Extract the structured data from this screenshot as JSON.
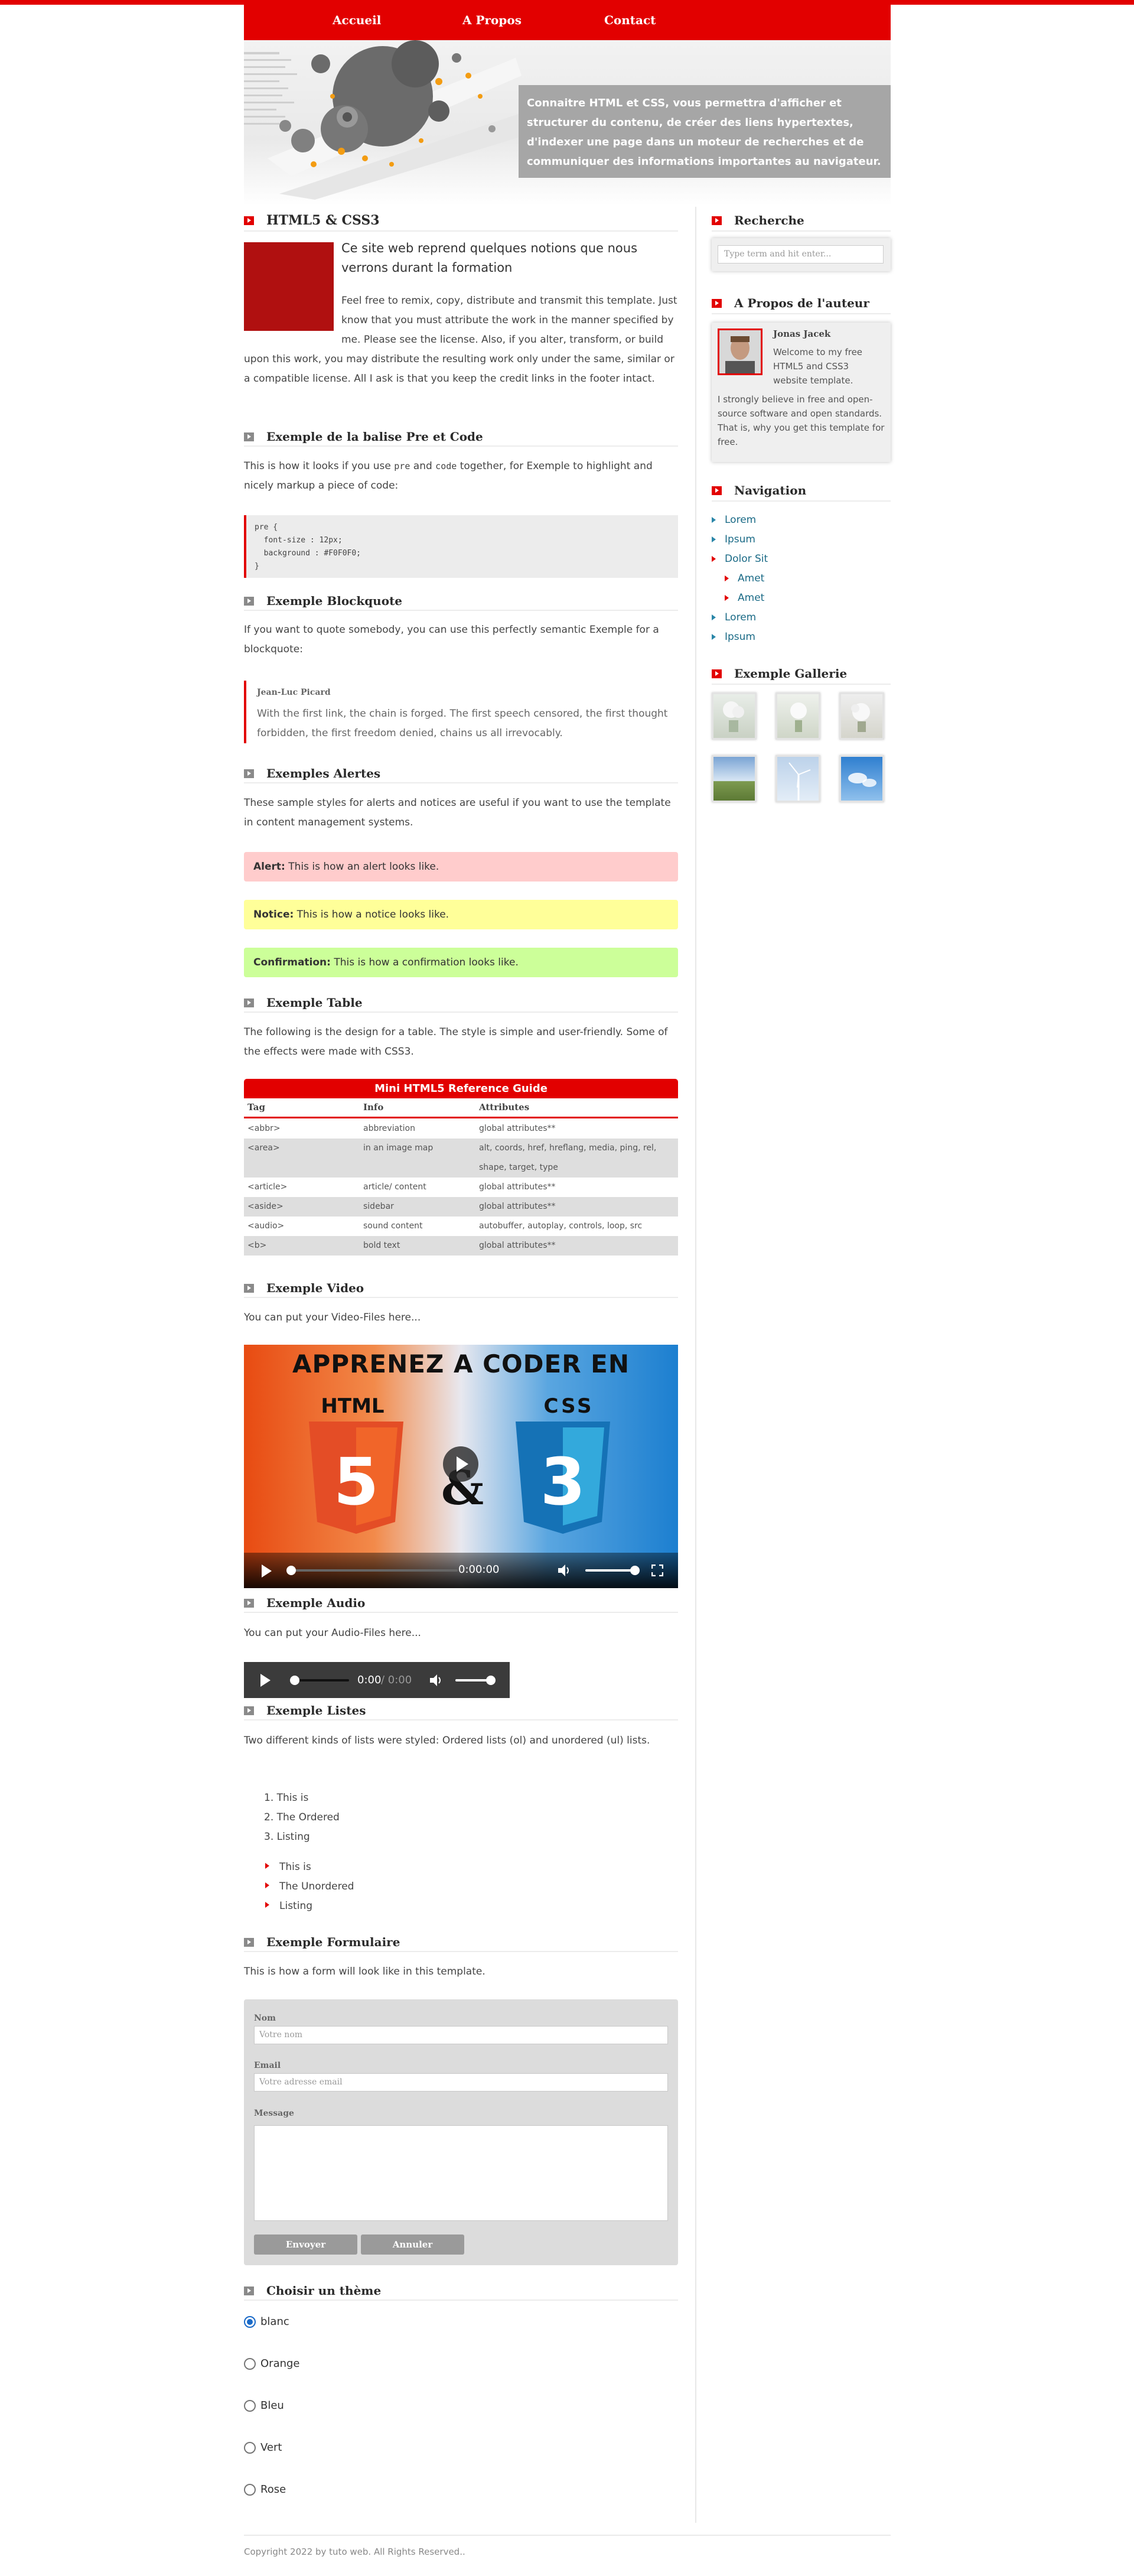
{
  "nav": {
    "home": "Accueil",
    "about": "A Propos",
    "contact": "Contact"
  },
  "banner": {
    "text": "Connaitre HTML et CSS, vous permettra d'afficher et structurer du contenu, de créer des liens hypertextes, d'indexer une page dans un moteur de recherches et de communiquer des informations importantes au navigateur."
  },
  "intro": {
    "title": "HTML5 & CSS3",
    "lead": "Ce site web reprend quelques notions que nous verrons durant la formation",
    "body": "Feel free to remix, copy, distribute and transmit this template. Just know that you must attribute the work in the manner specified by me. Please see the license. Also, if you alter, transform, or build upon this work, you may distribute the resulting work only under the same, similar or a compatible license. All I ask is that you keep the credit links in the footer intact."
  },
  "pre": {
    "title": "Exemple de la balise Pre et Code",
    "text_a": "This is how it looks if you use ",
    "code1": "pre",
    "text_b": " and ",
    "code2": "code",
    "text_c": " together, for Exemple to highlight and nicely markup a piece of code:",
    "code": "pre {\n  font-size : 12px;\n  background : #F0F0F0;\n}"
  },
  "blockquote": {
    "title": "Exemple Blockquote",
    "intro": "If you want to quote somebody, you can use this perfectly semantic Exemple for a blockquote:",
    "author": "Jean-Luc Picard",
    "quote": "With the first link, the chain is forged. The first speech censored, the first thought forbidden, the first freedom denied, chains us all irrevocably."
  },
  "alerts": {
    "title": "Exemples Alertes",
    "intro": "These sample styles for alerts and notices are useful if you want to use the template in content management systems.",
    "alert_label": "Alert:",
    "alert_text": " This is how an alert looks like.",
    "notice_label": "Notice:",
    "notice_text": " This is how a notice looks like.",
    "confirm_label": "Confirmation:",
    "confirm_text": " This is how a confirmation looks like.",
    "colors": {
      "alert": "#ffcccc",
      "notice": "#ffff99",
      "confirm": "#ccff99"
    }
  },
  "table": {
    "title": "Exemple Table",
    "intro": "The following is the design for a table. The style is simple and user-friendly. Some of the effects were made with CSS3.",
    "caption": "Mini HTML5 Reference Guide",
    "headers": [
      "Tag",
      "Info",
      "Attributes"
    ],
    "rows": [
      [
        "<abbr>",
        "abbreviation",
        "global attributes**"
      ],
      [
        "<area>",
        "in an image map",
        "alt, coords, href, hreflang, media, ping, rel,",
        "shape, target, type"
      ],
      [
        "<article>",
        "article/ content",
        "global attributes**"
      ],
      [
        "<aside>",
        "sidebar",
        "global attributes**"
      ],
      [
        "<audio>",
        "sound content",
        "autobuffer, autoplay, controls, loop, src"
      ],
      [
        "<b>",
        "bold text",
        "global attributes**"
      ]
    ]
  },
  "video": {
    "title": "Exemple Video",
    "intro": "You can put your Video-Files here...",
    "poster_title": "APPRENEZ A CODER EN",
    "html_label": "HTML",
    "css_label": "CSS",
    "time": "0:00:00"
  },
  "audio": {
    "title": "Exemple Audio",
    "intro": "You can put your Audio-Files here...",
    "current": "0:00",
    "total": " / 0:00"
  },
  "lists": {
    "title": "Exemple Listes",
    "intro": "Two different kinds of lists were styled: Ordered lists (ol) and unordered (ul) lists.",
    "ordered": [
      "This is",
      "The Ordered",
      "Listing"
    ],
    "unordered": [
      "This is",
      "The Unordered",
      "Listing"
    ]
  },
  "form": {
    "title": "Exemple Formulaire",
    "intro": "This is how a form will look like in this template.",
    "name_label": "Nom",
    "name_placeholder": "Votre nom",
    "email_label": "Email",
    "email_placeholder": "Votre adresse email",
    "message_label": "Message",
    "submit": "Envoyer",
    "cancel": "Annuler"
  },
  "theme": {
    "title": "Choisir un thème",
    "options": [
      "blanc",
      "Orange",
      "Bleu",
      "Vert",
      "Rose"
    ],
    "selected": "blanc"
  },
  "sidebar": {
    "search_title": "Recherche",
    "search_placeholder": "Type term and hit enter...",
    "author_title": "A Propos de l'auteur",
    "author_name": "Jonas Jacek",
    "author_welcome": "Welcome to my free HTML5 and CSS3 website template.",
    "author_text": "I strongly believe in free and open-source software and open standards. That is, why you get this template for free.",
    "nav_title": "Navigation",
    "nav_items": [
      "Lorem",
      "Ipsum",
      "Dolor Sit",
      "Amet",
      "Amet",
      "Lorem",
      "Ipsum"
    ],
    "gallery_title": "Exemple Gallerie"
  },
  "footer": {
    "text": "Copyright 2022 by tuto web. All Rights Reserved.."
  },
  "colors": {
    "accent": "#e20000",
    "link": "#1a6a86"
  }
}
